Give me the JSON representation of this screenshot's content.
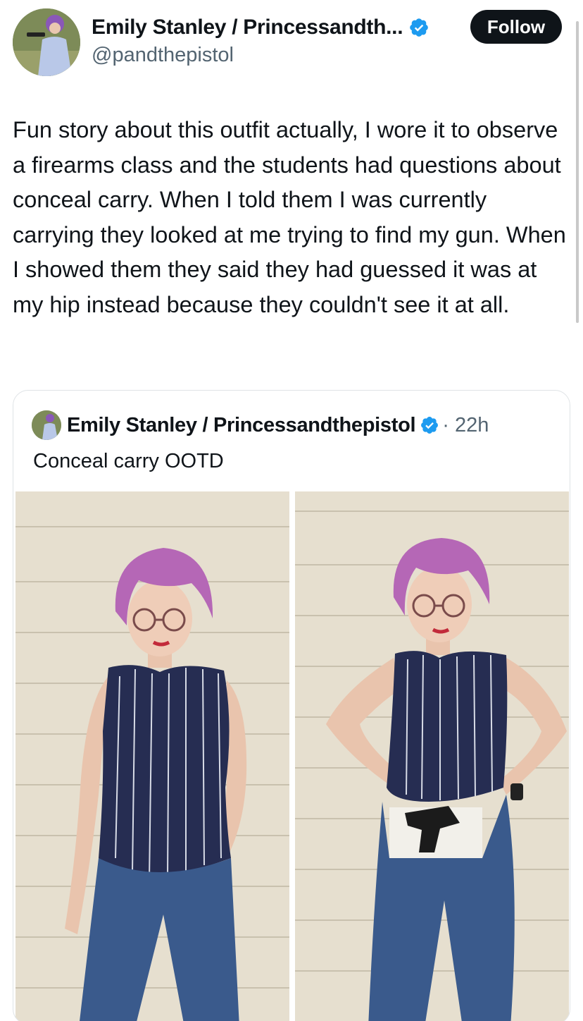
{
  "tweet": {
    "author": {
      "display_name": "Emily Stanley / Princessandth...",
      "handle": "@pandthepistol",
      "avatar_icon": "profile-avatar"
    },
    "follow_label": "Follow",
    "text": "Fun story about this outfit actually, I wore it to observe a firearms class and the students had questions about conceal carry. When I told them I was currently carrying they looked at me trying to find my gun. When I showed them they said they had guessed it was at my hip instead because they couldn't see it at all."
  },
  "quoted": {
    "display_name": "Emily Stanley / Princessandthepistol",
    "time": "· 22h",
    "text": "Conceal carry OOTD",
    "photos": [
      {
        "description_icon": "outfit-photo-front"
      },
      {
        "description_icon": "outfit-photo-holster"
      }
    ]
  },
  "colors": {
    "verified_blue": "#1d9bf0",
    "text_primary": "#0f1419",
    "text_secondary": "#536471",
    "follow_bg": "#0f1419"
  }
}
